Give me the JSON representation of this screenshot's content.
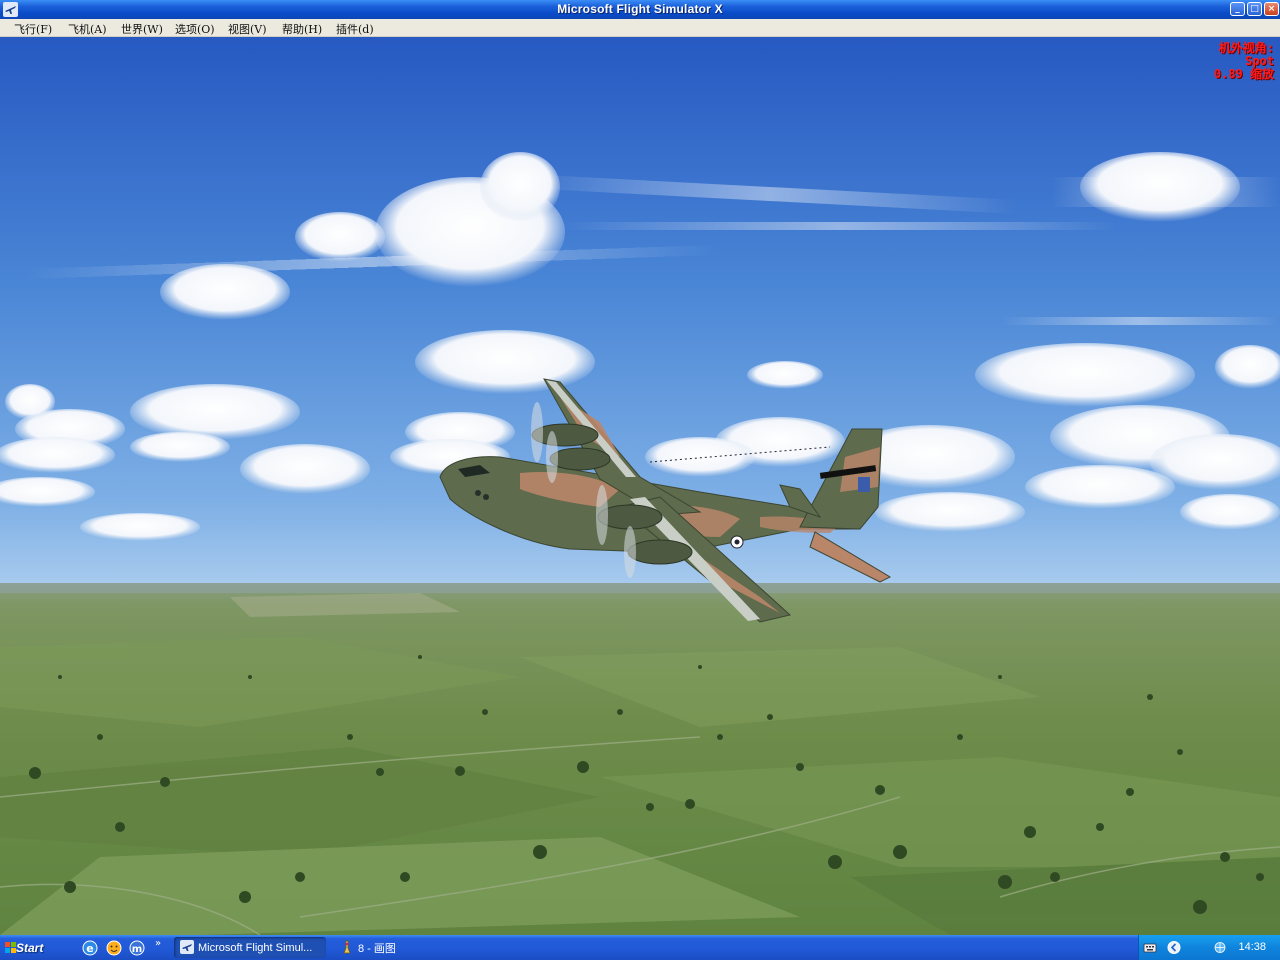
{
  "window": {
    "title": "Microsoft Flight Simulator X",
    "buttons": {
      "minimize": "_",
      "maximize": "□",
      "close": "×"
    }
  },
  "menu": [
    {
      "label": "飞行(F)"
    },
    {
      "label": "飞机(A)"
    },
    {
      "label": "世界(W)"
    },
    {
      "label": "选项(O)"
    },
    {
      "label": "视图(V)"
    },
    {
      "label": "帮助(H)"
    },
    {
      "label": "插件(d)"
    }
  ],
  "hud": {
    "view_label": "机外视角:",
    "view_mode": "Spot",
    "zoom": "0.89 缩放"
  },
  "taskbar": {
    "start_label": "Start",
    "quick_launch_icons": [
      "internet-explorer-icon",
      "messenger-icon",
      "maxthon-icon"
    ],
    "tasks": [
      {
        "label": "Microsoft Flight Simul...",
        "icon": "airplane-icon",
        "active": true
      },
      {
        "label": "8 - 画图",
        "icon": "paint-icon",
        "active": false
      }
    ],
    "clock": "14:38"
  },
  "colors": {
    "sky_top": "#2a63c9",
    "sky_horizon": "#9fc3ea",
    "ground": "#6f8d4e",
    "hud_text": "#ff1a1a",
    "aircraft_green": "#5e6b4c",
    "aircraft_tan": "#b9866a"
  }
}
